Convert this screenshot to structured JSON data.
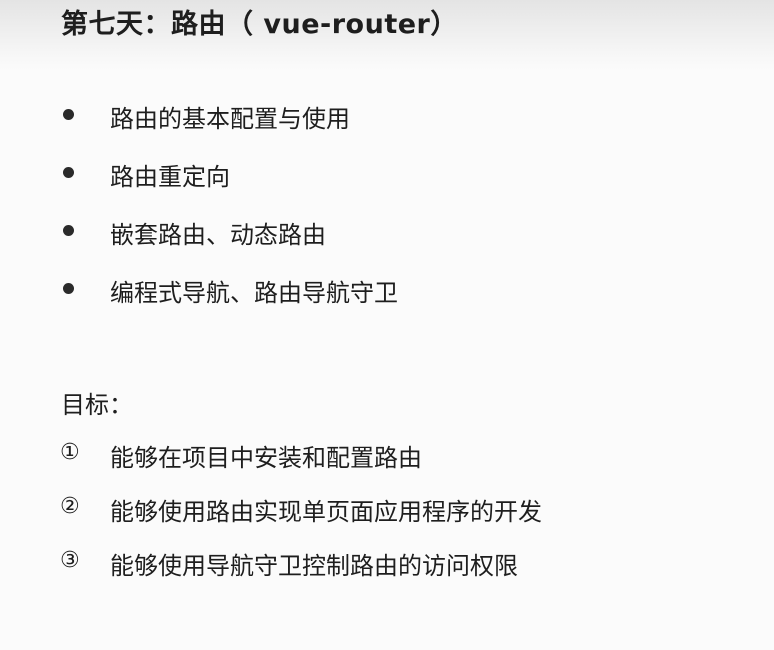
{
  "slide": {
    "title": "第七天：路由（ vue-router）",
    "bullets": [
      "路由的基本配置与使用",
      "路由重定向",
      "嵌套路由、动态路由",
      "编程式导航、路由导航守卫"
    ],
    "goals_label": "目标：",
    "goals": [
      {
        "num": "①",
        "text": "能够在项目中安装和配置路由"
      },
      {
        "num": "②",
        "text": "能够使用路由实现单页面应用程序的开发"
      },
      {
        "num": "③",
        "text": "能够使用导航守卫控制路由的访问权限"
      }
    ]
  }
}
